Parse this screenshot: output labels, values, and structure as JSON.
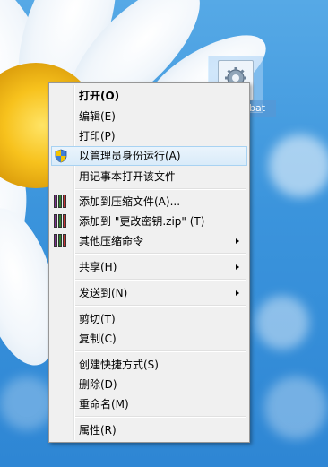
{
  "desktop": {
    "file_label": "bat"
  },
  "menu": {
    "items": [
      {
        "label": "打开(O)"
      },
      {
        "label": "编辑(E)"
      },
      {
        "label": "打印(P)"
      },
      {
        "label": "以管理员身份运行(A)"
      },
      {
        "label": "用记事本打开该文件"
      },
      {
        "label": "添加到压缩文件(A)..."
      },
      {
        "label": "添加到 \"更改密钥.zip\" (T)"
      },
      {
        "label": "其他压缩命令"
      },
      {
        "label": "共享(H)"
      },
      {
        "label": "发送到(N)"
      },
      {
        "label": "剪切(T)"
      },
      {
        "label": "复制(C)"
      },
      {
        "label": "创建快捷方式(S)"
      },
      {
        "label": "删除(D)"
      },
      {
        "label": "重命名(M)"
      },
      {
        "label": "属性(R)"
      }
    ]
  },
  "icons": {
    "run_as_admin": "uac-shield-icon",
    "archive": "winrar-books-icon",
    "submenu": "chevron-right-icon"
  },
  "colors": {
    "highlight_fill": "#d9ebf9",
    "highlight_border": "#a8d2f2",
    "menu_bg": "#f0f0f0"
  }
}
